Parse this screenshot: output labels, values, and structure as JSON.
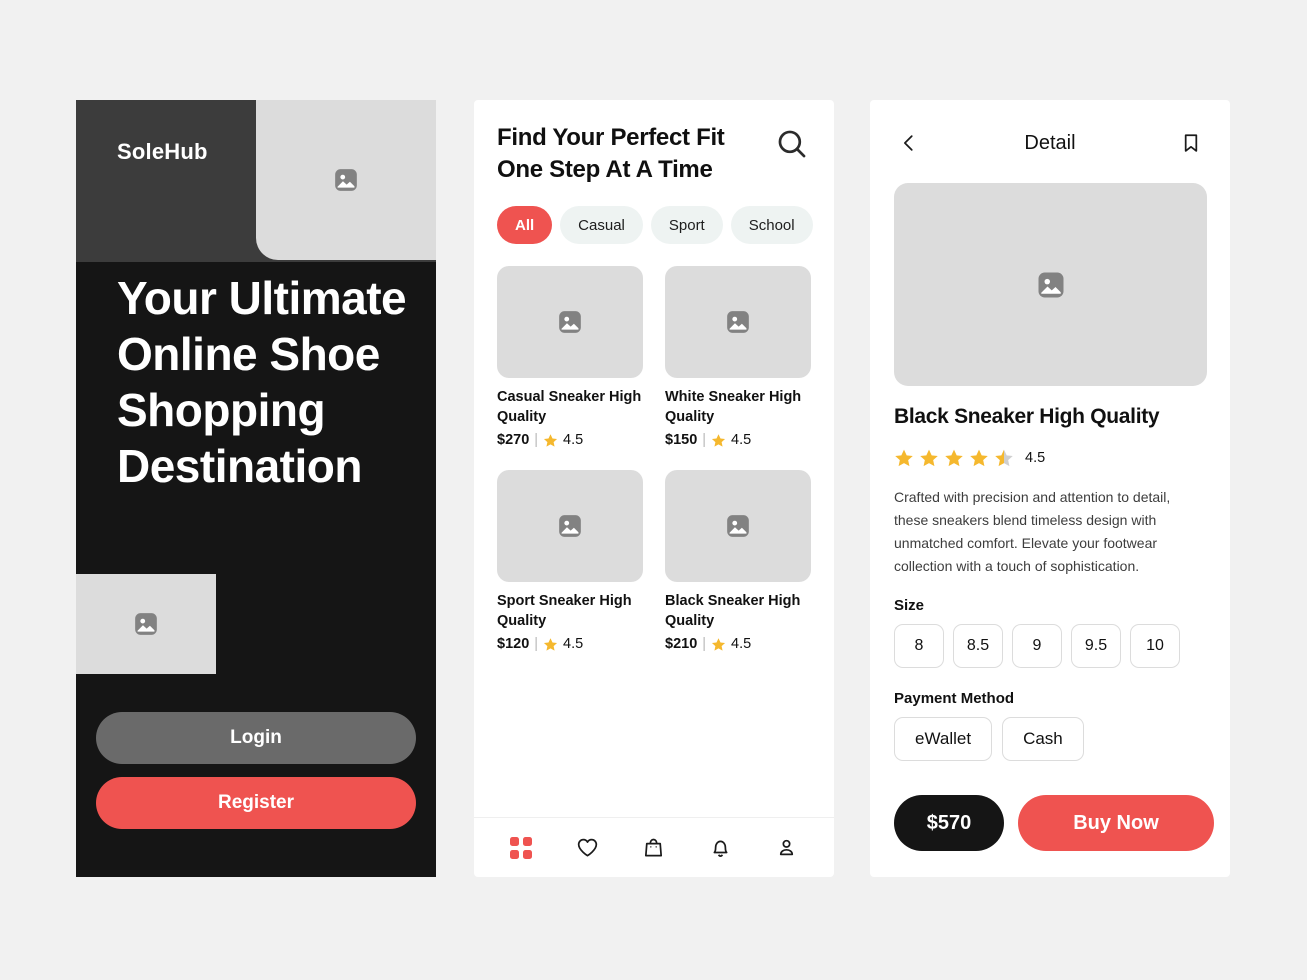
{
  "theme": {
    "page_bg": "#f1f1f1",
    "accent_red": "#ef5350",
    "dark": "#151515",
    "placeholder_gray": "#dcdcdc",
    "star_gold": "#f5b82e",
    "chip_bg": "#eef3f2"
  },
  "onboarding": {
    "brand": "SoleHub",
    "headline": "Your Ultimate Online Shoe Shopping Destination",
    "login_label": "Login",
    "register_label": "Register",
    "hero_image_icon": "image-placeholder-icon",
    "sub_image_icon": "image-placeholder-icon"
  },
  "home": {
    "title": "Find Your Perfect Fit One Step At A Time",
    "search_icon": "search-icon",
    "chips": [
      {
        "label": "All",
        "active": true
      },
      {
        "label": "Casual",
        "active": false
      },
      {
        "label": "Sport",
        "active": false
      },
      {
        "label": "School",
        "active": false
      }
    ],
    "products": [
      {
        "name": "Casual Sneaker High Quality",
        "price": "$270",
        "divider": "|",
        "rating": "4.5"
      },
      {
        "name": "White Sneaker High Quality",
        "price": "$150",
        "divider": "|",
        "rating": "4.5"
      },
      {
        "name": "Sport Sneaker High Quality",
        "price": "$120",
        "divider": "|",
        "rating": "4.5"
      },
      {
        "name": "Black Sneaker High Quality",
        "price": "$210",
        "divider": "|",
        "rating": "4.5"
      }
    ],
    "nav": [
      {
        "icon": "grid-icon",
        "active": true
      },
      {
        "icon": "heart-icon",
        "active": false
      },
      {
        "icon": "shopping-bag-icon",
        "active": false
      },
      {
        "icon": "bell-icon",
        "active": false
      },
      {
        "icon": "person-icon",
        "active": false
      }
    ]
  },
  "detail": {
    "back_icon": "chevron-left-icon",
    "title": "Detail",
    "bookmark_icon": "bookmark-icon",
    "hero_image_icon": "image-placeholder-icon",
    "product_name": "Black Sneaker High Quality",
    "rating_value": "4.5",
    "stars_filled": 4,
    "stars_half": 1,
    "description": "Crafted with precision and attention to detail, these sneakers blend timeless design with unmatched comfort. Elevate your footwear collection with a touch of sophistication.",
    "size_label": "Size",
    "sizes": [
      "8",
      "8.5",
      "9",
      "9.5",
      "10"
    ],
    "payment_label": "Payment Method",
    "payment_methods": [
      "eWallet",
      "Cash"
    ],
    "price": "$570",
    "buy_label": "Buy Now"
  }
}
